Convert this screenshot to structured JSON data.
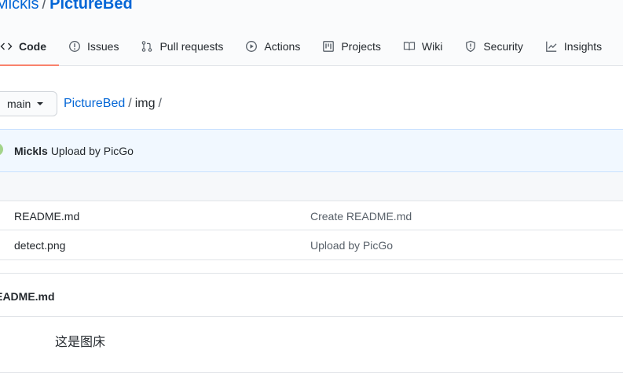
{
  "repo": {
    "owner": "Mickls",
    "separator": "/",
    "name": "PictureBed"
  },
  "tabs": [
    {
      "label": "Code",
      "icon": "code-icon",
      "selected": true
    },
    {
      "label": "Issues",
      "icon": "issue-icon"
    },
    {
      "label": "Pull requests",
      "icon": "pull-request-icon"
    },
    {
      "label": "Actions",
      "icon": "play-icon"
    },
    {
      "label": "Projects",
      "icon": "project-icon"
    },
    {
      "label": "Wiki",
      "icon": "book-icon"
    },
    {
      "label": "Security",
      "icon": "shield-icon"
    },
    {
      "label": "Insights",
      "icon": "graph-icon"
    },
    {
      "label": "",
      "icon": "gear-icon"
    }
  ],
  "branch": {
    "label": "main"
  },
  "breadcrumb": {
    "root": "PictureBed",
    "sep": "/",
    "part": "img",
    "trail": "/"
  },
  "commit": {
    "author": "Mickls",
    "message": "Upload by PicGo"
  },
  "files": [
    {
      "name": "README.md",
      "message": "Create README.md"
    },
    {
      "name": "detect.png",
      "message": "Upload by PicGo"
    }
  ],
  "readme": {
    "title": "README.md",
    "body": "这是图床"
  },
  "colors": {
    "link": "#0366d6",
    "tab_underline": "#f9826c",
    "commit_bg": "#f1f8ff"
  }
}
